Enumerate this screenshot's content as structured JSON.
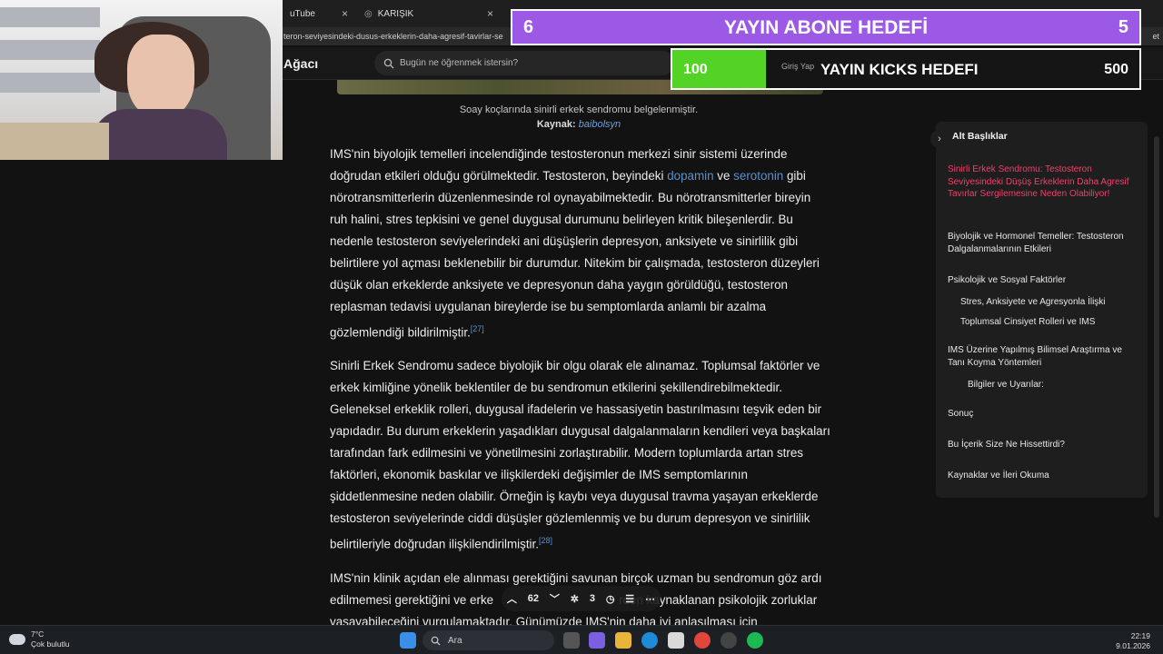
{
  "browser": {
    "tabs": [
      {
        "label": "uTube",
        "close": "×"
      },
      {
        "label": "KARIŞIK",
        "close": "×"
      }
    ],
    "address": "teron-seviyesindeki-dusus-erkeklerin-daha-agresif-tavirlar-se",
    "address_right": "et"
  },
  "site": {
    "brand": "Ağacı",
    "search_placeholder": "Bugün ne öğrenmek istersin?",
    "login_label": "Giriş Yap"
  },
  "overlay": {
    "sub_goal": {
      "current": "6",
      "title": "YAYIN ABONE HEDEFİ",
      "target": "5"
    },
    "kicks_goal": {
      "current": "100",
      "title": "YAYIN KICKS HEDEFI",
      "target": "500",
      "progress": 0.2
    }
  },
  "article": {
    "caption": "Soay koçlarında sinirli erkek sendromu belgelenmiştir.",
    "source_label": "Kaynak:",
    "source_link": "baibolsyn",
    "p1_a": "IMS'nin biyolojik temelleri incelendiğinde testosteronun merkezi sinir sistemi üzerinde doğrudan etkileri olduğu görülmektedir. Testosteron, beyindeki ",
    "p1_link1": "dopamin",
    "p1_b": " ve ",
    "p1_link2": "serotonin",
    "p1_c": " gibi nörotransmitterlerin düzenlenmesinde rol oynayabilmektedir. Bu nörotransmitterler bireyin ruh halini, stres tepkisini ve genel duygusal durumunu belirleyen kritik bileşenlerdir. Bu nedenle testosteron seviyelerindeki ani düşüşlerin depresyon, anksiyete ve sinirlilik gibi belirtilere yol açması beklenebilir bir durumdur. Nitekim bir çalışmada, testosteron düzeyleri düşük olan erkeklerde anksiyete ve depresyonun daha yaygın görüldüğü, testosteron replasman tedavisi uygulanan bireylerde ise bu semptomlarda anlamlı bir azalma gözlemlendiği bildirilmiştir.",
    "p1_ref": "[27]",
    "p2": "Sinirli Erkek Sendromu sadece biyolojik bir olgu olarak ele alınamaz. Toplumsal faktörler ve erkek kimliğine yönelik beklentiler de bu sendromun etkilerini şekillendirebilmektedir. Geleneksel erkeklik rolleri, duygusal ifadelerin ve hassasiyetin bastırılmasını teşvik eden bir yapıdadır. Bu durum erkeklerin yaşadıkları duygusal dalgalanmaların kendileri veya başkaları tarafından fark edilmesini ve yönetilmesini zorlaştırabilir. Modern toplumlarda artan stres faktörleri, ekonomik baskılar ve ilişkilerdeki değişimler de IMS semptomlarının şiddetlenmesine neden olabilir. Örneğin iş kaybı veya duygusal travma yaşayan erkeklerde testosteron seviyelerinde ciddi düşüşler gözlemlenmiş ve bu durum depresyon ve sinirlilik belirtileriyle doğrudan ilişkilendirilmiştir.",
    "p2_ref": "[28]",
    "p3_a": "IMS'nin klinik açıdan ele alınması gerektiğini savunan birçok uzman bu sendromun göz ardı edilmemesi gerektiğini ve erke",
    "p3_b": "rden kaynaklanan psikolojik zorluklar yaşayabileceğini vurgulamaktadır. Günümüzde IMS'nin daha iyi anlaşılması için"
  },
  "toc": {
    "title": "Alt Başlıklar",
    "items": [
      "Sinirli Erkek Sendromu: Testosteron Seviyesindeki Düşüş Erkeklerin Daha Agresif Tavırlar Sergilemesine Neden Olabiliyor!",
      "Biyolojik ve Hormonel Temeller: Testosteron Dalgalanmalarının Etkileri",
      "Psikolojik ve Sosyal Faktörler",
      "Stres, Anksiyete ve Agresyonla İlişki",
      "Toplumsal Cinsiyet Rolleri ve IMS",
      "IMS Üzerine Yapılmış Bilimsel Araştırma ve Tanı Koyma Yöntemleri",
      "Bilgiler ve Uyarılar:",
      "Sonuç",
      "Bu İçerik Size Ne Hissettirdi?",
      "Kaynaklar ve İleri Okuma"
    ]
  },
  "floatbar": {
    "votes": "62",
    "shares": "3"
  },
  "taskbar": {
    "temp": "7°C",
    "weather": "Çok bulutlu",
    "search": "Ara",
    "time": "22:19",
    "date": "9.01.2026"
  }
}
